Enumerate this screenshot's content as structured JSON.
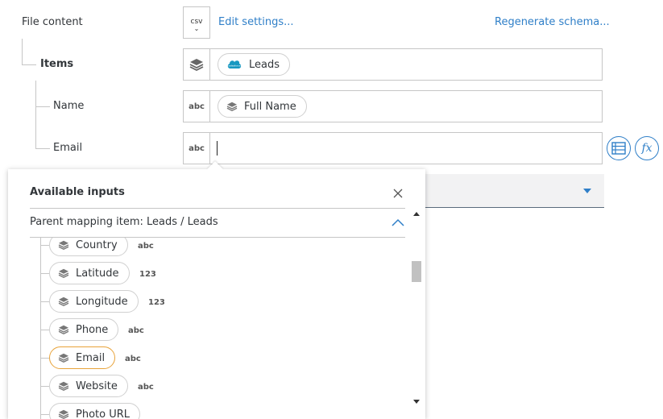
{
  "rows": {
    "file_content": {
      "label": "File content",
      "type_badge": "csv",
      "edit_link": "Edit settings...",
      "regen_link": "Regenerate schema..."
    },
    "items": {
      "label": "Items",
      "value": "Leads"
    },
    "name": {
      "label": "Name",
      "type_badge": "abc",
      "value": "Full Name"
    },
    "email": {
      "label": "Email",
      "type_badge": "abc",
      "value": ""
    }
  },
  "panel": {
    "title": "Available inputs",
    "parent_label": "Parent mapping item: Leads / Leads",
    "items": [
      {
        "label": "Country",
        "type": "abc",
        "selected": false
      },
      {
        "label": "Latitude",
        "type": "123",
        "selected": false
      },
      {
        "label": "Longitude",
        "type": "123",
        "selected": false
      },
      {
        "label": "Phone",
        "type": "abc",
        "selected": false
      },
      {
        "label": "Email",
        "type": "abc",
        "selected": true
      },
      {
        "label": "Website",
        "type": "abc",
        "selected": false
      },
      {
        "label": "Photo URL",
        "type": "",
        "selected": false
      }
    ]
  },
  "colors": {
    "accent": "#2f7fc8",
    "selected_border": "#e8a33a",
    "salesforce": "#1798c1"
  },
  "icons": [
    "layers-icon",
    "salesforce-icon",
    "list-icon",
    "fx-icon",
    "close-icon",
    "chevron-up-icon",
    "chevron-down-icon",
    "scroll-up-icon",
    "scroll-down-icon"
  ]
}
